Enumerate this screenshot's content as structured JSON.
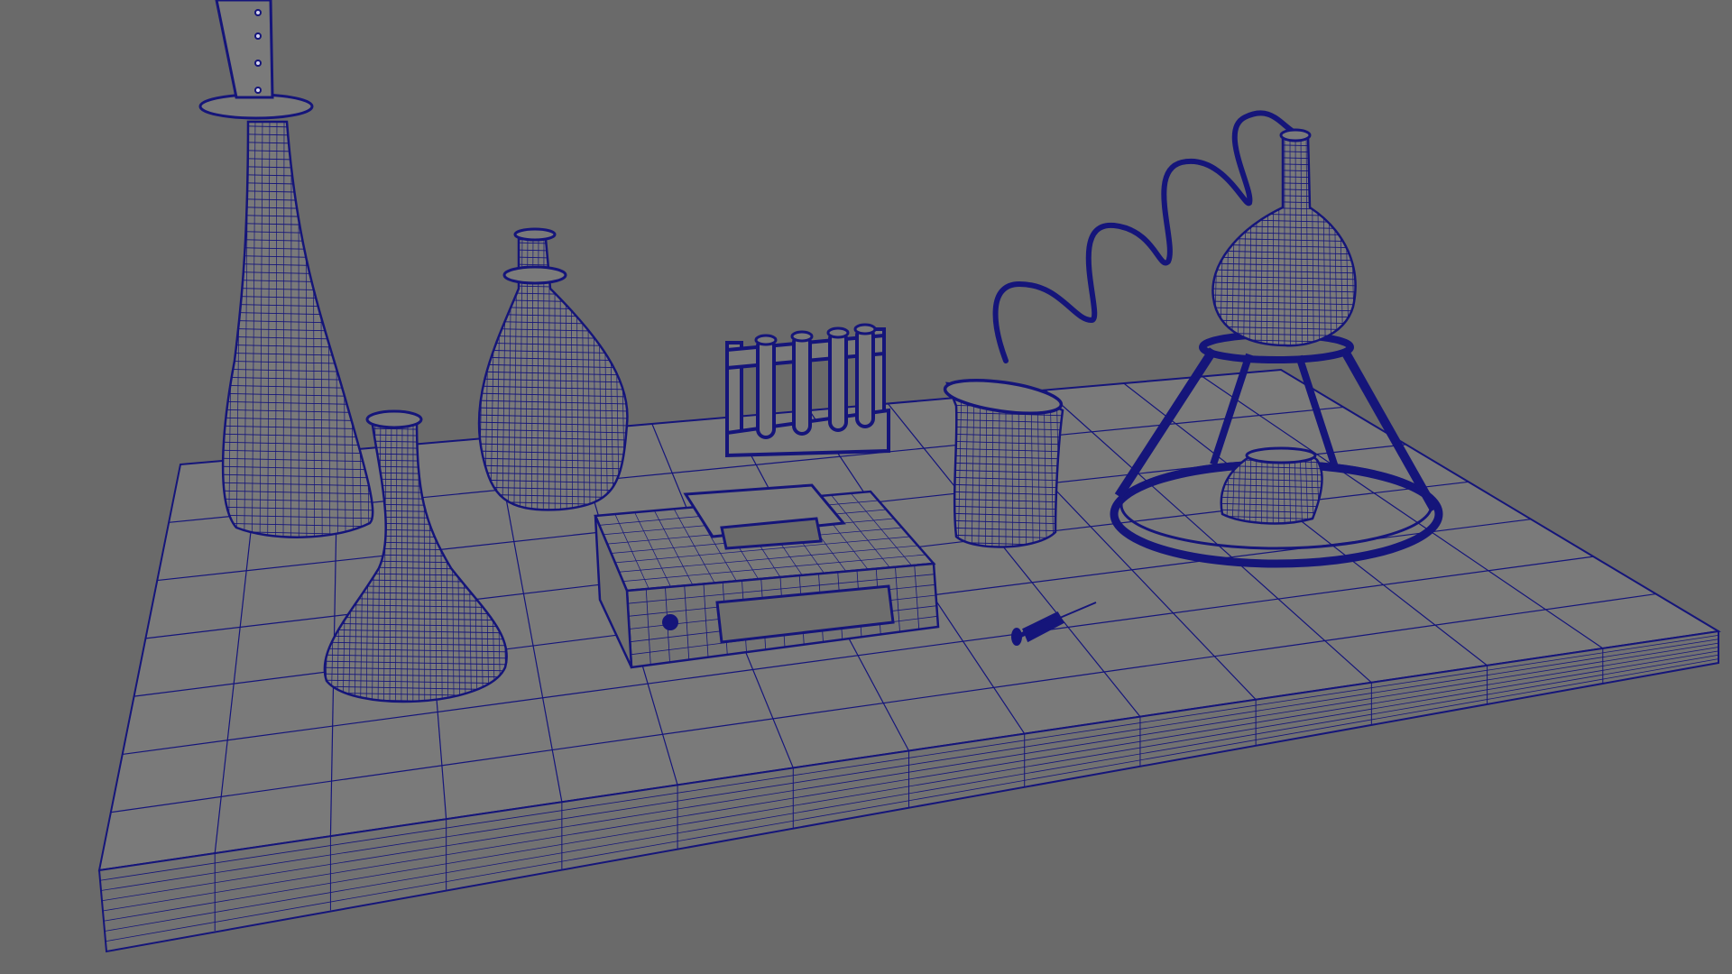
{
  "viewport": {
    "background_color": "#6a6a6a",
    "wire_color": "#15157a",
    "surface_color": "#7a7a7a",
    "display_mode": "wireframe-on-shaded"
  },
  "objects": [
    "table-slab",
    "tall-flask",
    "erlenmeyer-flask",
    "decanter-bottle",
    "test-tube-rack",
    "box-device",
    "beaker",
    "syringe",
    "coiled-tube",
    "round-bottom-flask",
    "tripod-stand",
    "burner"
  ]
}
